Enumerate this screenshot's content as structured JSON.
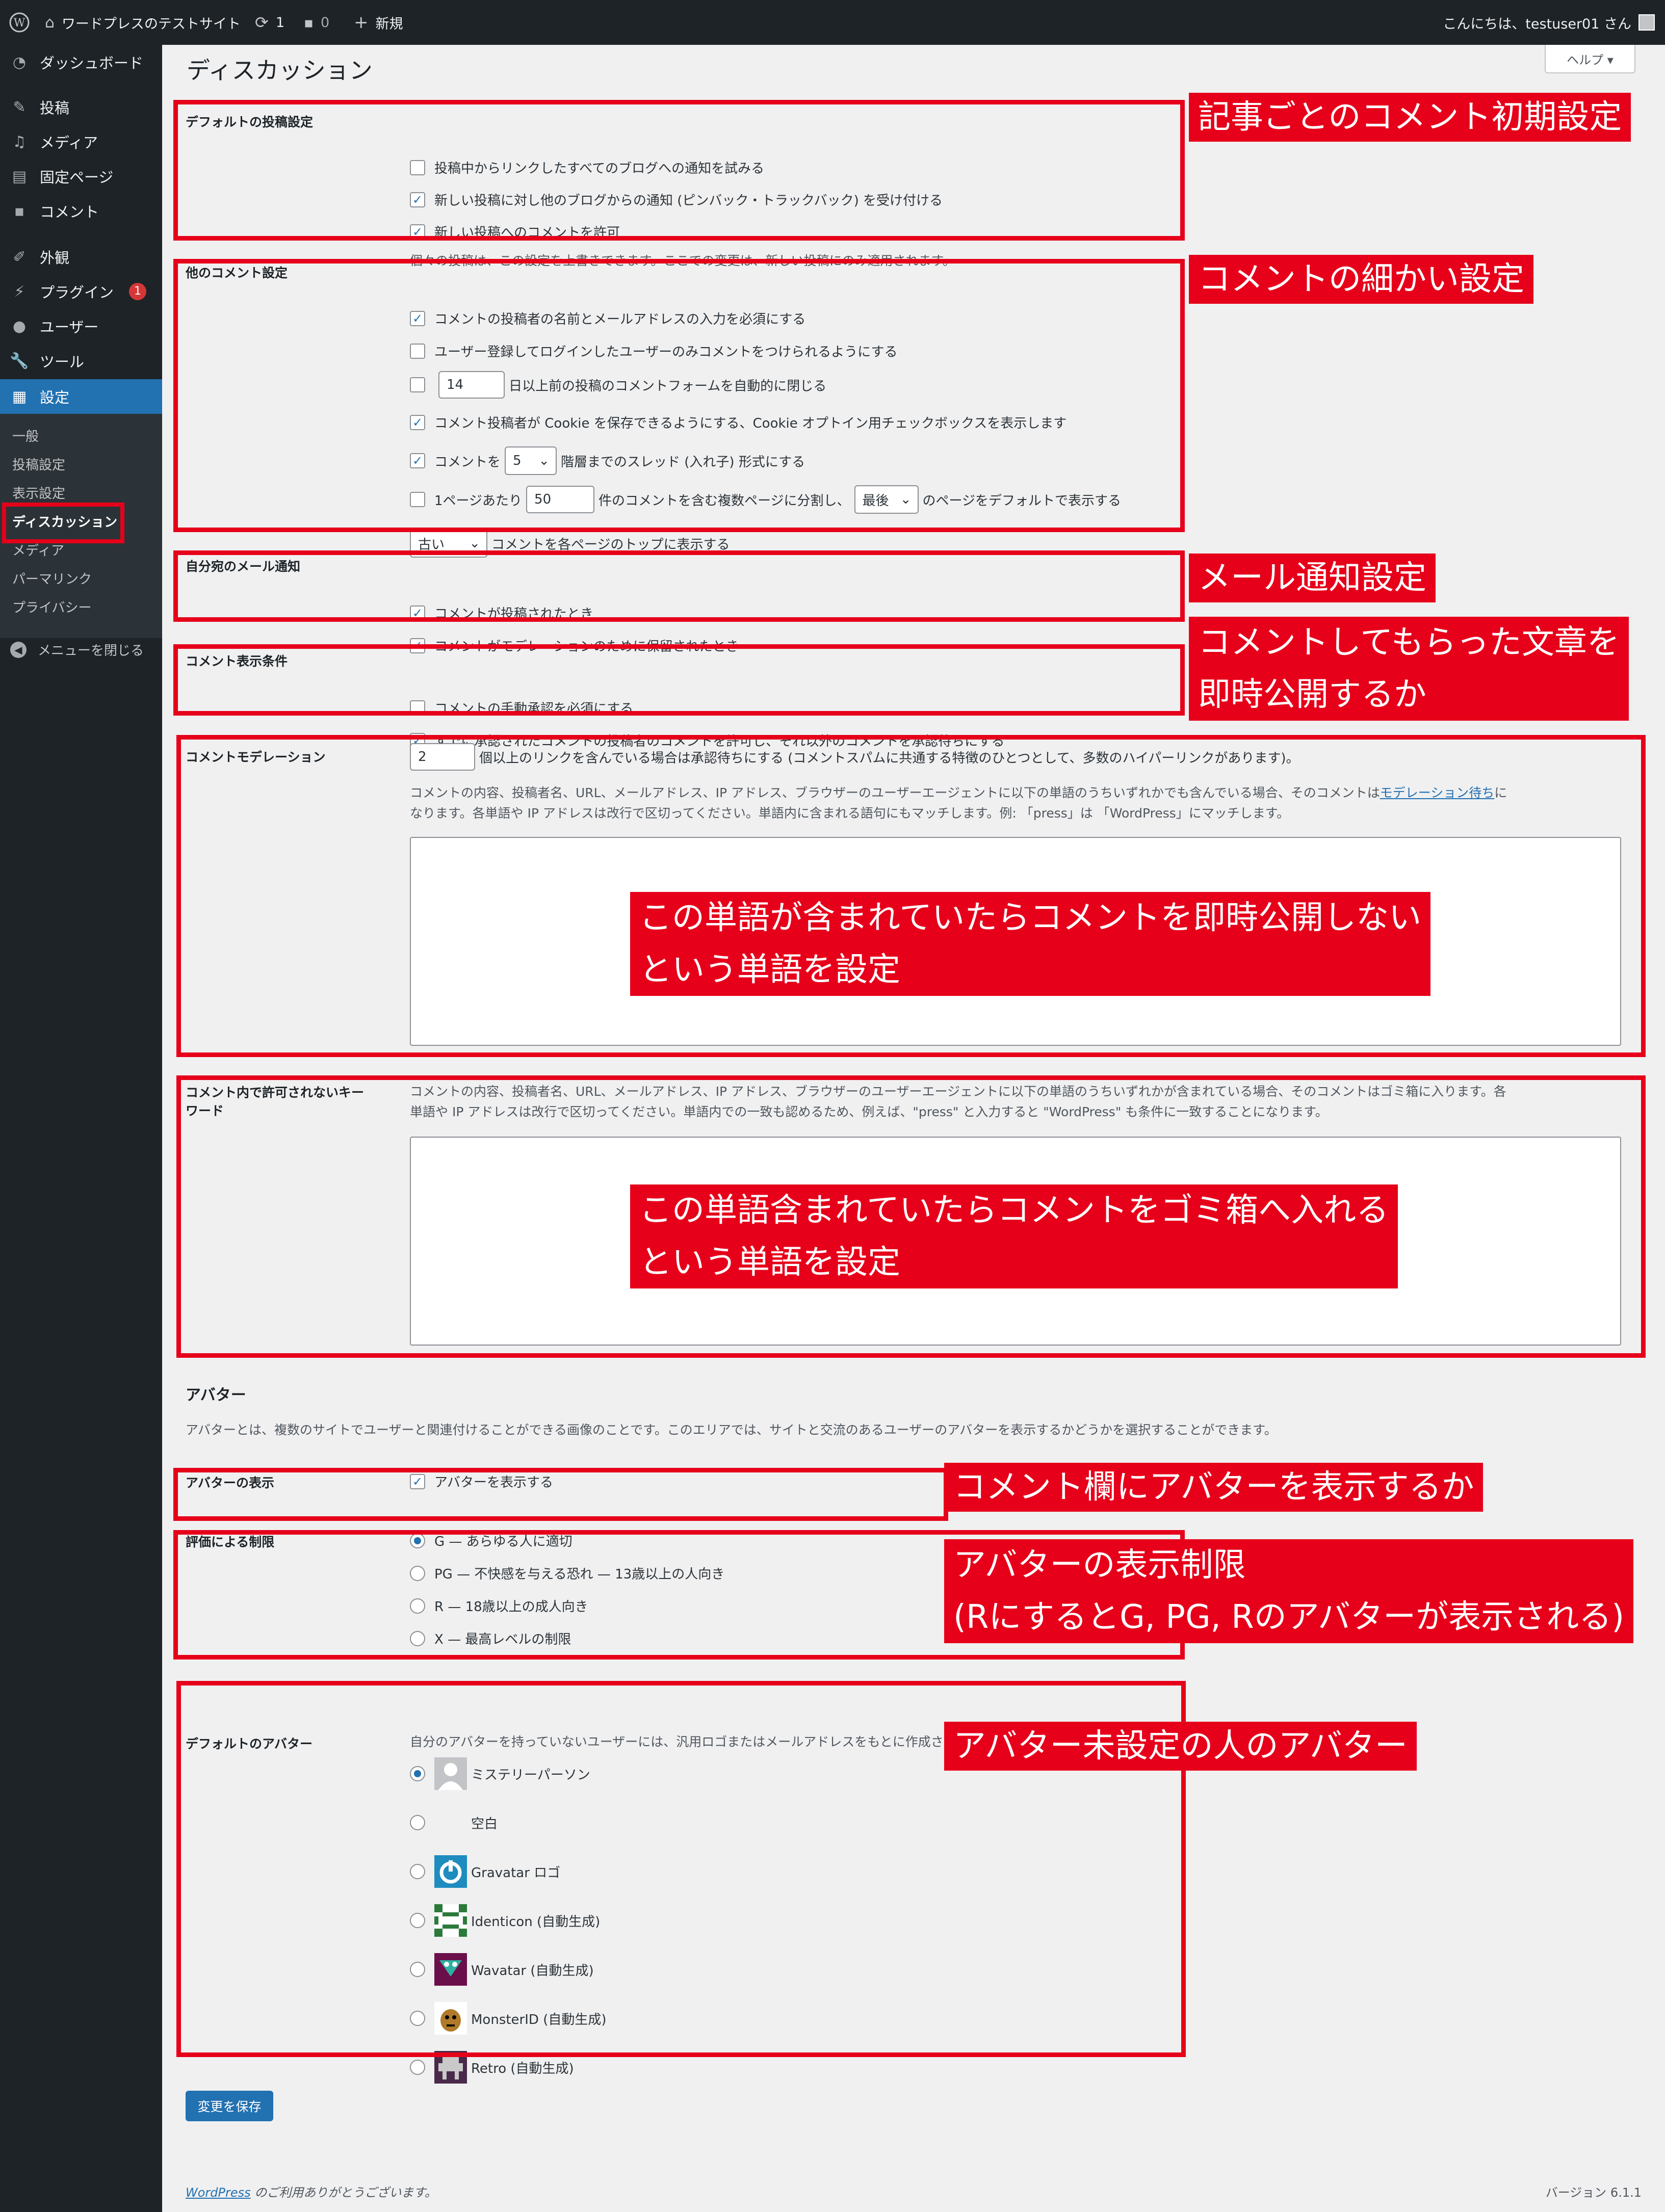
{
  "adminbar": {
    "site_name": "ワードプレスのテストサイト",
    "updates": "1",
    "comments": "0",
    "new": "新規",
    "greeting": "こんにちは、testuser01 さん"
  },
  "sidebar": {
    "items": [
      "ダッシュボード",
      "投稿",
      "メディア",
      "固定ページ",
      "コメント",
      "外観",
      "プラグイン",
      "ユーザー",
      "ツール",
      "設定"
    ],
    "plugin_badge": "1",
    "sub": [
      "一般",
      "投稿設定",
      "表示設定",
      "ディスカッション",
      "メディア",
      "パーマリンク",
      "プライバシー"
    ],
    "collapse": "メニューを閉じる"
  },
  "help": "ヘルプ ▾",
  "title": "ディスカッション",
  "s1": {
    "th": "デフォルトの投稿設定",
    "o1": "投稿中からリンクしたすべてのブログへの通知を試みる",
    "o2": "新しい投稿に対し他のブログからの通知 (ピンバック・トラックバック) を受け付ける",
    "o3": "新しい投稿へのコメントを許可",
    "desc": "個々の投稿は、この設定を上書きできます。ここでの変更は、新しい投稿にのみ適用されます。"
  },
  "s2": {
    "th": "他のコメント設定",
    "o1": "コメントの投稿者の名前とメールアドレスの入力を必須にする",
    "o2": "ユーザー登録してログインしたユーザーのみコメントをつけられるようにする",
    "days": "14",
    "o3": "日以上前の投稿のコメントフォームを自動的に閉じる",
    "o4": "コメント投稿者が Cookie を保存できるようにする、Cookie オプトイン用チェックボックスを表示します",
    "o5a": "コメントを",
    "depth": "5",
    "o5b": "階層までのスレッド (入れ子) 形式にする",
    "o6a": "1ページあたり",
    "per": "50",
    "o6b": "件のコメントを含む複数ページに分割し、",
    "last": "最後",
    "o6c": "のページをデフォルトで表示する",
    "older": "古い",
    "o7": "コメントを各ページのトップに表示する"
  },
  "s3": {
    "th": "自分宛のメール通知",
    "o1": "コメントが投稿されたとき",
    "o2": "コメントがモデレーションのために保留されたとき"
  },
  "s4": {
    "th": "コメント表示条件",
    "o1": "コメントの手動承認を必須にする",
    "o2": "すでに承認されたコメントの投稿者のコメントを許可し、それ以外のコメントを承認待ちにする"
  },
  "s5": {
    "th": "コメントモデレーション",
    "links": "2",
    "o1": "個以上のリンクを含んでいる場合は承認待ちにする (コメントスパムに共通する特徴のひとつとして、多数のハイパーリンクがあります)。",
    "d1": "コメントの内容、投稿者名、URL、メールアドレス、IP アドレス、ブラウザーのユーザーエージェントに以下の単語のうちいずれかでも含んでいる場合、そのコメントは",
    "d1link": "モデレーション待ち",
    "d1b": "に",
    "d2": "なります。各単語や IP アドレスは改行で区切ってください。単語内に含まれる語句にもマッチします。例: 「press」は 「WordPress」にマッチします。"
  },
  "s6": {
    "th1": "コメント内で許可されないキー",
    "th2": "ワード",
    "d1": "コメントの内容、投稿者名、URL、メールアドレス、IP アドレス、ブラウザーのユーザーエージェントに以下の単語のうちいずれかが含まれている場合、そのコメントはゴミ箱に入ります。各",
    "d2": "単語や IP アドレスは改行で区切ってください。単語内での一致も認めるため、例えば、\"press\" と入力すると \"WordPress\" も条件に一致することになります。"
  },
  "avatar": {
    "heading": "アバター",
    "desc": "アバターとは、複数のサイトでユーザーと関連付けることができる画像のことです。このエリアでは、サイトと交流のあるユーザーのアバターを表示するかどうかを選択することができます。",
    "show_th": "アバターの表示",
    "show": "アバターを表示する",
    "rating_th": "評価による制限",
    "ratings": [
      "G — あらゆる人に適切",
      "PG — 不快感を与える恐れ — 13歳以上の人向き",
      "R — 18歳以上の成人向き",
      "X — 最高レベルの制限"
    ],
    "default_th": "デフォルトのアバター",
    "default_desc": "自分のアバターを持っていないユーザーには、汎用ロゴまたはメールアドレスをもとに作成される画像を表示できます。",
    "defaults": [
      "ミステリーパーソン",
      "空白",
      "Gravatar ロゴ",
      "Identicon (自動生成)",
      "Wavatar (自動生成)",
      "MonsterID (自動生成)",
      "Retro (自動生成)"
    ]
  },
  "save": "変更を保存",
  "footer": {
    "wp": "WordPress",
    "thanks": " のご利用ありがとうございます。",
    "version": "バージョン 6.1.1"
  },
  "callouts": {
    "c1": "記事ごとのコメント初期設定",
    "c2": "コメントの細かい設定",
    "c3": "メール通知設定",
    "c4a": "コメントしてもらった文章を",
    "c4b": "即時公開するか",
    "c5a": "この単語が含まれていたらコメントを即時公開しない",
    "c5b": "という単語を設定",
    "c6a": "この単語含まれていたらコメントをゴミ箱へ入れる",
    "c6b": "という単語を設定",
    "c7": "コメント欄にアバターを表示するか",
    "c8a": "アバターの表示制限",
    "c8b": "(RにするとG, PG, Rのアバターが表示される)",
    "c9": "アバター未設定の人のアバター"
  }
}
